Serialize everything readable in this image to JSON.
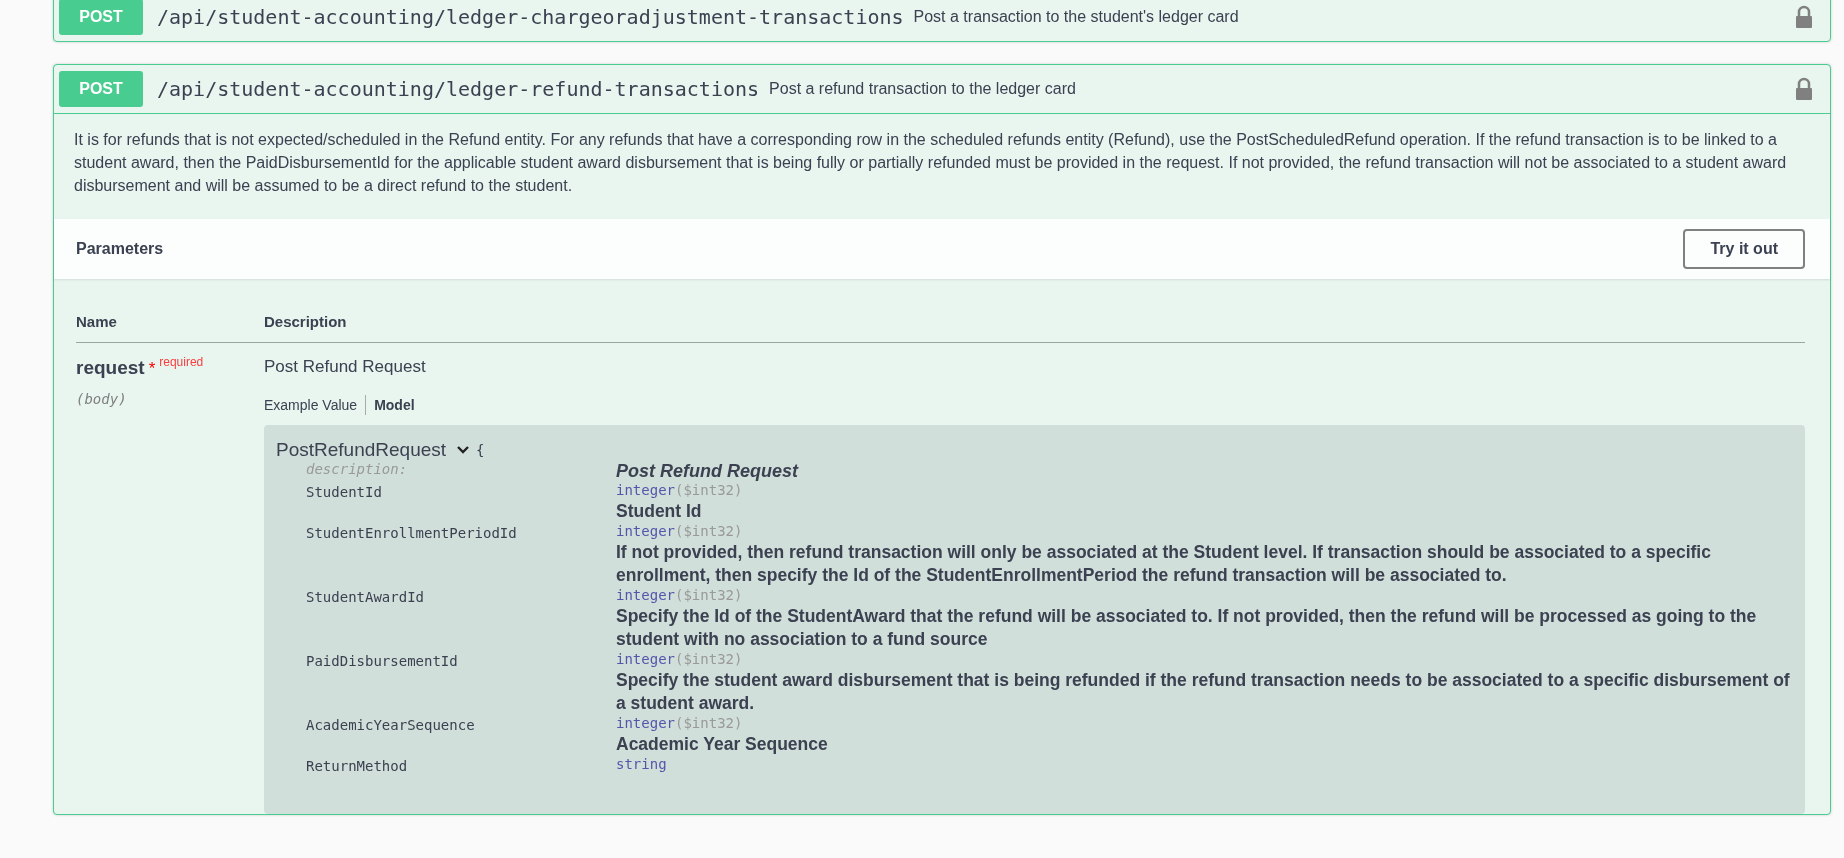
{
  "operations": [
    {
      "method": "POST",
      "path": "/api/student-accounting/ledger-chargeoradjustment-transactions",
      "summary": "Post a transaction to the student's ledger card",
      "locked": true
    },
    {
      "method": "POST",
      "path": "/api/student-accounting/ledger-refund-transactions",
      "summary": "Post a refund transaction to the ledger card",
      "locked": true,
      "details": {
        "description": "It is for refunds that is not expected/scheduled in the Refund entity. For any refunds that have a corresponding row in the scheduled refunds entity (Refund), use the PostScheduledRefund operation. If the refund transaction is to be linked to a student award, then the PaidDisbursementId for the applicable student award disbursement that is being fully or partially refunded must be provided in the request. If not provided, the refund transaction will not be associated to a student award disbursement and will be assumed to be a direct refund to the student.",
        "parameters_title": "Parameters",
        "try_button": "Try it out",
        "columns": [
          "Name",
          "Description"
        ],
        "parameters": [
          {
            "name": "request",
            "required_mark": "*",
            "required_label": "required",
            "location": "(body)",
            "description": "Post Refund Request",
            "tabs": [
              {
                "label": "Example Value",
                "selected": false
              },
              {
                "label": "Model",
                "selected": true
              }
            ],
            "model": {
              "name": "PostRefundRequest",
              "expanded": true,
              "brace": "{",
              "description_label": "description:",
              "description_value": "Post Refund Request",
              "properties": [
                {
                  "name": "StudentId",
                  "type": "integer",
                  "format": "($int32)",
                  "description": "Student Id"
                },
                {
                  "name": "StudentEnrollmentPeriodId",
                  "type": "integer",
                  "format": "($int32)",
                  "description": "If not provided, then refund transaction will only be associated at the Student level. If transaction should be associated to a specific enrollment, then specify the Id of the StudentEnrollmentPeriod the refund transaction will be associated to."
                },
                {
                  "name": "StudentAwardId",
                  "type": "integer",
                  "format": "($int32)",
                  "description": "Specify the Id of the StudentAward that the refund will be associated to. If not provided, then the refund will be processed as going to the student with no association to a fund source"
                },
                {
                  "name": "PaidDisbursementId",
                  "type": "integer",
                  "format": "($int32)",
                  "description": "Specify the student award disbursement that is being refunded if the refund transaction needs to be associated to a specific disbursement of a student award."
                },
                {
                  "name": "AcademicYearSequence",
                  "type": "integer",
                  "format": "($int32)",
                  "description": "Academic Year Sequence"
                },
                {
                  "name": "ReturnMethod",
                  "type": "string"
                }
              ]
            }
          }
        ]
      }
    }
  ]
}
